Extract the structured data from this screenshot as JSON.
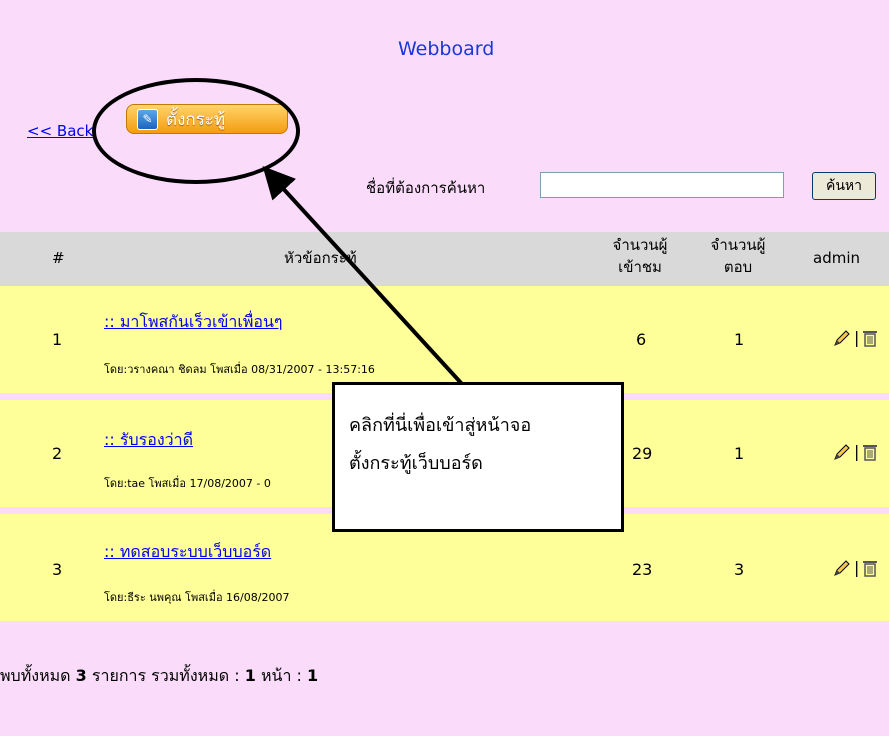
{
  "header": {
    "title": "Webboard",
    "back_link": "<< Back",
    "new_topic_button": "ตั้งกระทู้"
  },
  "search": {
    "label": "ชื่อที่ต้องการค้นหา",
    "value": "",
    "button": "ค้นหา"
  },
  "table": {
    "headers": {
      "number": "#",
      "topic": "หัวข้อกระทู้",
      "views_line1": "จำนวนผู้",
      "views_line2": "เข้าชม",
      "replies_line1": "จำนวนผู้",
      "replies_line2": "ตอบ",
      "admin": "admin"
    },
    "rows": [
      {
        "num": "1",
        "title": ":: มาโพสกันเร็วเข้าเพื่อนๆ",
        "meta": "โดย:วรางคณา ชิดลม โพสเมื่อ 08/31/2007 - 13:57:16",
        "views": "6",
        "replies": "1"
      },
      {
        "num": "2",
        "title": ":: รับรองว่าดี",
        "meta": "โดย:tae โพสเมื่อ 17/08/2007 - 0",
        "views": "29",
        "replies": "1"
      },
      {
        "num": "3",
        "title": ":: ทดสอบระบบเว็บบอร์ด",
        "meta": "โดย:ธีระ นพคุณ โพสเมื่อ 16/08/2007",
        "views": "23",
        "replies": "3"
      }
    ],
    "admin_separator": "|"
  },
  "footer": {
    "prefix": "พบทั้งหมด",
    "total": "3",
    "middle": "รายการ รวมทั้งหมด :",
    "pages": "1",
    "page_word": "หน้า :",
    "current": "1"
  },
  "callout": {
    "line1": "คลิกที่นี่เพื่อเข้าสู่หน้าจอ",
    "line2": "ตั้งกระทู้เว็บบอร์ด"
  },
  "colors": {
    "page_background": "#fadcfa",
    "row_background": "#ffff99",
    "header_background": "#d9d9d9",
    "link": "#0000ee"
  },
  "icons": [
    "pen-icon",
    "edit-icon",
    "delete-icon"
  ]
}
